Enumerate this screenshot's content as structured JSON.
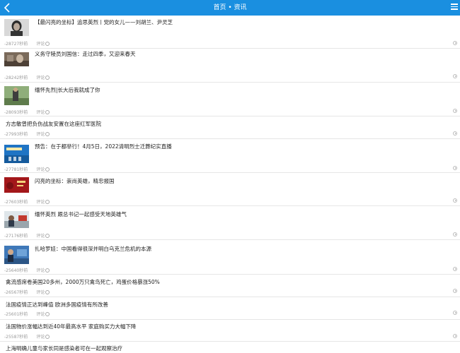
{
  "header": {
    "title": "首页 • 资讯"
  },
  "comment_label": "评论",
  "articles": [
    {
      "title": "【最闪亮的坐标】追思英烈丨党的女儿——刘胡兰、尹灵芝",
      "time": "-28727秒前"
    },
    {
      "title": "义务守陵员刘国信：走过四季，又迎来春天",
      "time": "-28242秒前"
    },
    {
      "title": "缅怀先烈|长大后我就成了你",
      "time": "-28093秒前"
    },
    {
      "title": "方志敏曾把负伤战友安置在这座红军医院",
      "time": "-27993秒前"
    },
    {
      "title": "预告：在于都举行！4月5日，2022清明烈士迁葬纪实直播",
      "time": "-27781秒前"
    },
    {
      "title": "闪亮的坐标：崇尚英雄，精忠报国",
      "time": "-27603秒前"
    },
    {
      "title": "缅怀英烈 跟总书记一起感受天地英雄气",
      "time": "-27176秒前"
    },
    {
      "title": "扎哈罗娃：中国看得很深并明白乌克兰危机的本源",
      "time": "-25640秒前"
    },
    {
      "title": "禽流感席卷美国20多州，2000万只禽鸟死亡，鸡蛋价格暴涨50%",
      "time": "-26567秒前"
    },
    {
      "title": "法国疫情正达到峰值 欧洲多国疫情有所改善",
      "time": "-25601秒前"
    },
    {
      "title": "法国物价涨幅达到近40年最高水平 家庭购买力大幅下降",
      "time": "-25587秒前"
    },
    {
      "title": "上海明确儿童与家长同是感染者可在一起观察治疗",
      "time": ""
    }
  ]
}
